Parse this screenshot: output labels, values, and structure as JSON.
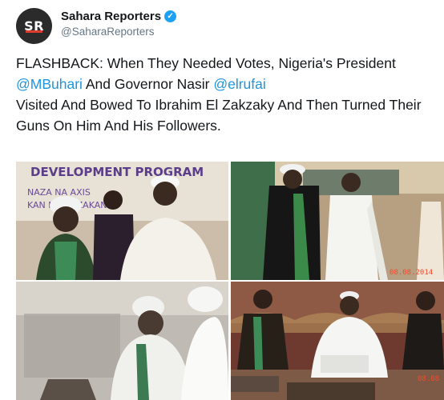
{
  "account": {
    "avatar_text": "SR",
    "display_name": "Sahara Reporters",
    "handle": "@SaharaReporters"
  },
  "tweet": {
    "t1": "FLASHBACK: When They Needed Votes, Nigeria's President ",
    "m1": "@MBuhari",
    "t2": " And Governor Nasir ",
    "m2": "@elrufai",
    "t3": " Visited And Bowed To Ibrahim El Zakzaky And Then Turned Their Guns On Him And His Followers."
  },
  "media": {
    "banner_line1": "DEVELOPMENT PROGRAM",
    "banner_line2": "NAZA  NA  AXIS",
    "banner_line3": "KAN  NA ILI  ZAKAN",
    "stamp_top_right": "08.08.2014",
    "stamp_bottom_right": "08.08"
  },
  "colors": {
    "mention": "#1b95e0",
    "verified": "#1da1f2"
  },
  "icons": {
    "verified": "verified-badge-icon"
  }
}
